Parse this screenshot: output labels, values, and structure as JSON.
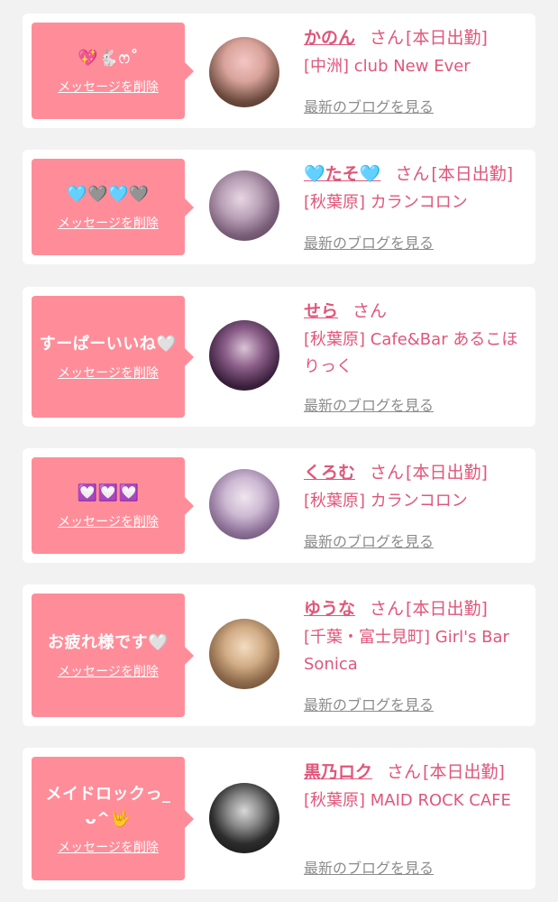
{
  "delete_label": "メッセージを削除",
  "blog_label": "最新のブログを見る",
  "san_label": "さん",
  "colors": {
    "page_bg": "#f2f2f2",
    "card_bg": "#ffffff",
    "bubble_bg": "#ff8d99",
    "accent": "#e0567a",
    "link_gray": "#8c8c8c"
  },
  "items": [
    {
      "message": "💖🐇ෆ˚",
      "name": "かのん",
      "status": "[本日出勤]",
      "shop": "[中洲] club New Ever",
      "avatar_icon": "avatar-photo"
    },
    {
      "message": "🩵🩶🩵🩶",
      "name": "🩵たそ🩵",
      "status": "[本日出勤]",
      "shop": "[秋葉原] カランコロン",
      "avatar_icon": "avatar-photo"
    },
    {
      "message": "すーぱーいいね🤍",
      "name": "せら",
      "status": "",
      "shop": "[秋葉原] Cafe&Bar あるこほりっく",
      "avatar_icon": "avatar-photo"
    },
    {
      "message": "💟💟💟",
      "name": "くろむ",
      "status": "[本日出勤]",
      "shop": "[秋葉原] カランコロン",
      "avatar_icon": "avatar-photo"
    },
    {
      "message": "お疲れ様です🤍",
      "name": "ゆうな",
      "status": "[本日出勤]",
      "shop": "[千葉・富士見町] Girl's Bar Sonica",
      "avatar_icon": "avatar-photo"
    },
    {
      "message": "メイドロックっ_ ᴗ^🤟",
      "name": "黒乃ロク",
      "status": "[本日出勤]",
      "shop": "[秋葉原] MAID ROCK CAFE",
      "avatar_icon": "avatar-photo"
    }
  ]
}
